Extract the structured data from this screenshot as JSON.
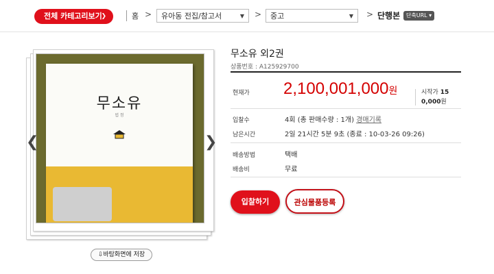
{
  "nav": {
    "category_button": "전체 카테고리보기",
    "home": "홈",
    "crumb1": "유아동 전집/참고서",
    "crumb2": "중고",
    "current": "단행본",
    "url_button": "단축URL"
  },
  "gallery": {
    "book_title": "무소유",
    "book_author": "법 정",
    "save_button": "바탕화면에 저장"
  },
  "product": {
    "title": "무소유  외2권",
    "product_no": "상품번호 : A125929700",
    "price_label": "현재가",
    "price": "2,100,001,000",
    "price_unit": "원",
    "start_label": "시작가 ",
    "start_price_a": "15",
    "start_price_b": "0,000",
    "start_unit": "원",
    "bids_label": "입찰수",
    "bids_value": "4회 (총 판매수량 : 1개) ",
    "bids_link": "경매기록",
    "remain_label": "남은시간",
    "remain_value": "2일 21시간 5분 9초 (종료 : 10-03-26 09:26)",
    "ship_label": "배송방법",
    "ship_value": "택배",
    "fee_label": "배송비",
    "fee_value": "무료",
    "bid_button": "입찰하기",
    "wish_button": "관심물품등록"
  }
}
